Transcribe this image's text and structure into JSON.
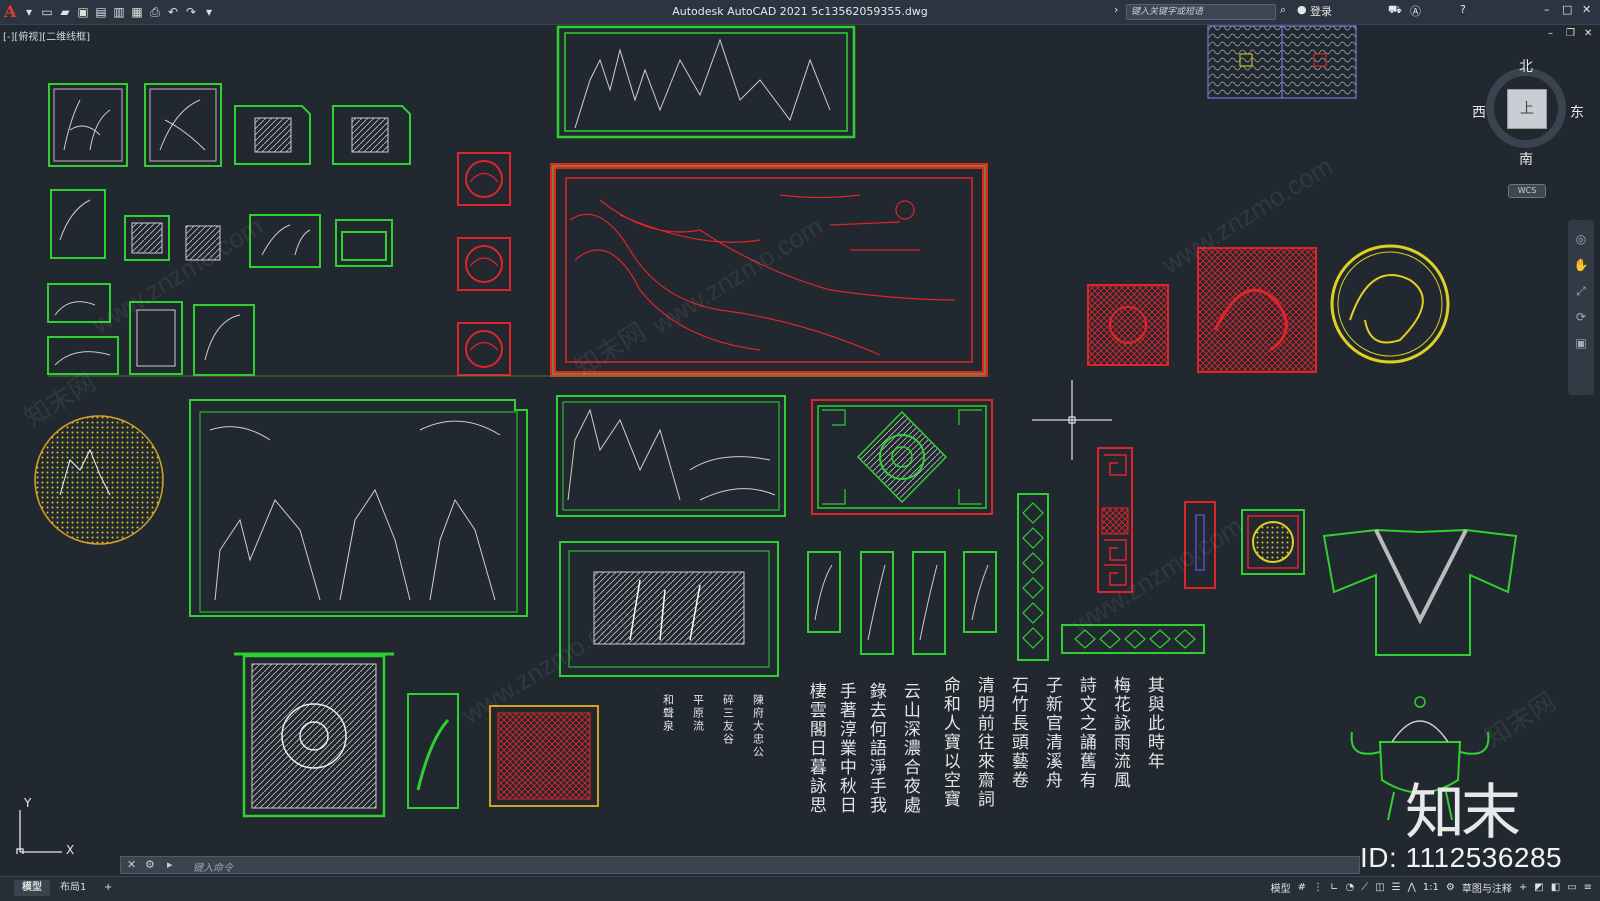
{
  "titlebar": {
    "app_logo": "A",
    "title": "Autodesk AutoCAD 2021    5c13562059355.dwg",
    "search_placeholder": "键入关键字或短语",
    "login": "登录"
  },
  "view_label": "[-][俯视][二维线框]",
  "viewcube": {
    "north": "北",
    "south": "南",
    "east": "东",
    "west": "西",
    "face": "上",
    "wcs": "WCS"
  },
  "command": {
    "prompt": "键入命令"
  },
  "status": {
    "tabs": [
      "模型",
      "布局1",
      "+"
    ],
    "model_label": "模型",
    "scale": "1:1",
    "workspace": "草图与注释"
  },
  "watermarks": {
    "id": "ID: 1112536285",
    "logo": "知末",
    "site": "www.znzmo.com",
    "site_cn": "知末网"
  },
  "ucs": {
    "x": "X",
    "y": "Y"
  },
  "colors": {
    "green": "#2fd02f",
    "red": "#e0242a",
    "yellow": "#e0d020",
    "white": "#d8d8d8"
  },
  "calligraphy": [
    "和聲泉",
    "平原流",
    "碎三友谷",
    "陳府大忠公",
    "棲雲閣日暮詠思",
    "手著淳業中秋日",
    "錄去何語淨手我",
    "云山深濃合夜處",
    "命和人寶以空寶",
    "清明前往來齋詞",
    "石竹長頭藝卷",
    "子新官清溪舟",
    "詩文之誦舊有",
    "梅花詠雨流風",
    "其與此時年"
  ]
}
